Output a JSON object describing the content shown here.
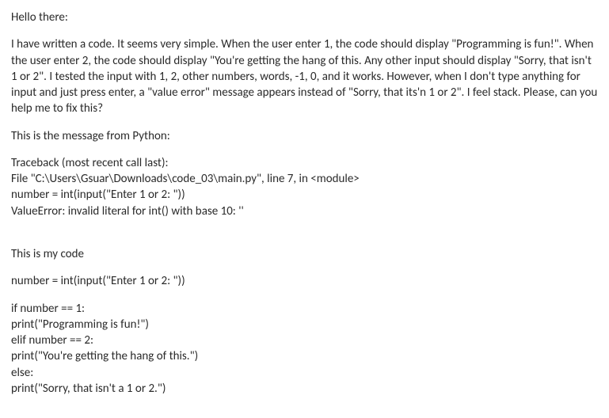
{
  "greeting": "Hello there:",
  "intro": "I have written a code. It seems very simple. When the user enter 1, the code should display \"Programming is fun!\". When the user enter 2, the code should display \"You're getting the hang of this. Any other input should display \"Sorry, that isn't 1 or 2\". I tested the input with 1, 2, other numbers, words, -1, 0, and it works. However, when I don't type anything for input and just press enter, a \"value error\" message appears instead of \"Sorry, that its'n 1 or 2\". I feel stack. Please, can you help me to fix this?",
  "msg_intro": "This is the message from Python:",
  "traceback": {
    "line1": "Traceback (most recent call last):",
    "line2": "File \"C:\\Users\\Gsuar\\Downloads\\code_03\\main.py\", line 7, in <module>",
    "line3": "number = int(input(\"Enter 1 or 2: \"))",
    "line4": "ValueError: invalid literal for int() with base 10: ''"
  },
  "code_intro": "This is my code",
  "code": {
    "line1": "number = int(input(\"Enter 1 or 2: \"))",
    "line2": "if number == 1:",
    "line3": "print(\"Programming is fun!\")",
    "line4": "elif number == 2:",
    "line5": "print(\"You're getting the hang of this.\")",
    "line6": "else:",
    "line7": "print(\"Sorry, that isn't a 1 or 2.\")"
  }
}
